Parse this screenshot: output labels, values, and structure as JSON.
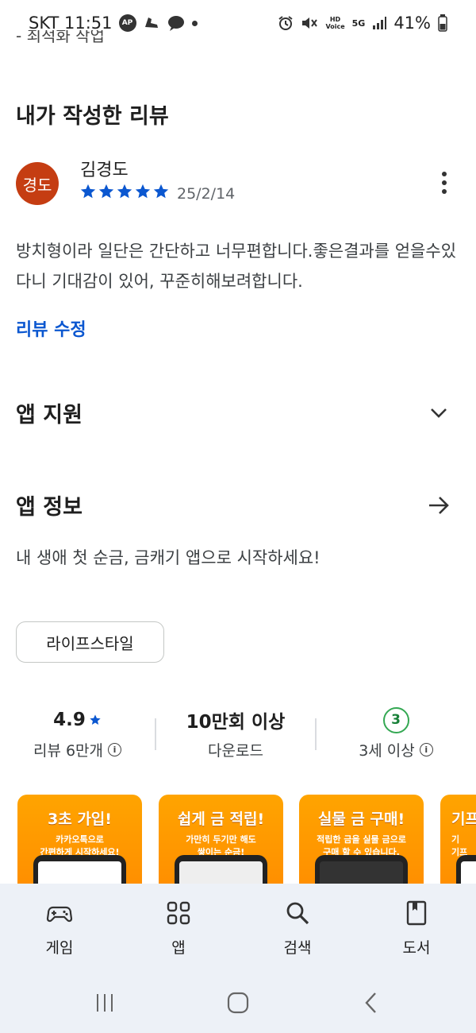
{
  "status_bar": {
    "carrier_time": "SKT 11:51",
    "battery": "41%",
    "hd_label": "HD\nVoice",
    "network": "5G"
  },
  "cut_text": "- 최적화 작업",
  "my_review": {
    "heading": "내가 작성한 리뷰",
    "avatar_text": "경도",
    "avatar_color": "#c53d12",
    "reviewer": "김경도",
    "rating": 5,
    "date": "25/2/14",
    "text": "방치형이라 일단은 간단하고 너무편합니다.좋은결과를 얻을수있다니 기대감이 있어, 꾸준히해보려합니다.",
    "edit_label": "리뷰 수정"
  },
  "app_support": {
    "title": "앱 지원"
  },
  "app_info": {
    "title": "앱 정보",
    "description": "내 생애 첫 순금, 금캐기 앱으로 시작하세요!",
    "category_chip": "라이프스타일"
  },
  "stats": {
    "rating": "4.9",
    "reviews_label": "리뷰 6만개",
    "downloads": "10만회 이상",
    "downloads_label": "다운로드",
    "age_badge": "3",
    "age_label": "3세 이상"
  },
  "screenshots": [
    {
      "title": "3초 가입!",
      "subtitle": "카카오톡으로\n간편하게 시작하세요!"
    },
    {
      "title": "쉽게 금 적립!",
      "subtitle": "가만히 두기만 해도\n쌓이는 순금!"
    },
    {
      "title": "실물 금 구매!",
      "subtitle": "적립한 금을 실물 금으로\n구매 할 수 있습니다."
    },
    {
      "title": "기프",
      "subtitle": "기\n기프"
    }
  ],
  "bottom_nav": [
    {
      "label": "게임",
      "icon": "gamepad-icon"
    },
    {
      "label": "앱",
      "icon": "apps-grid-icon"
    },
    {
      "label": "검색",
      "icon": "search-icon"
    },
    {
      "label": "도서",
      "icon": "book-icon"
    }
  ],
  "colors": {
    "accent_blue": "#0b57d0",
    "age_green": "#34a853",
    "screenshot_orange": "#ffa400"
  }
}
